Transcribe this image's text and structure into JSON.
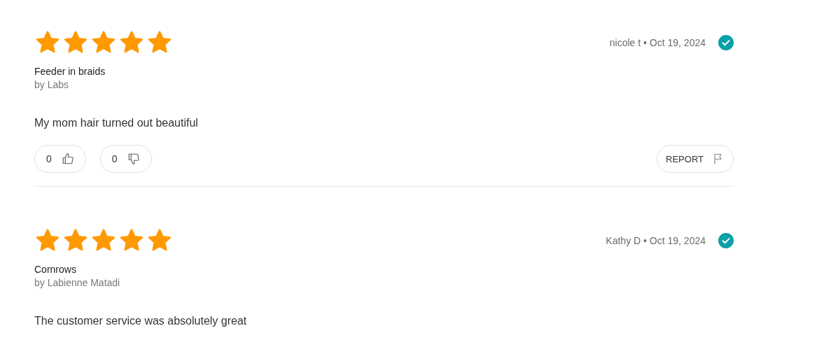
{
  "reviews": [
    {
      "stars": 5,
      "reviewer_line": "nicole t • Oct 19, 2024",
      "verified": true,
      "title": "Feeder in braids",
      "byline": "by Labs",
      "body": "My mom hair turned out beautiful",
      "helpful": "0",
      "unhelpful": "0",
      "report": "REPORT"
    },
    {
      "stars": 5,
      "reviewer_line": "Kathy D • Oct 19, 2024",
      "verified": true,
      "title": "Cornrows",
      "byline": "by Labienne Matadi",
      "body": "The customer service was absolutely great"
    }
  ]
}
